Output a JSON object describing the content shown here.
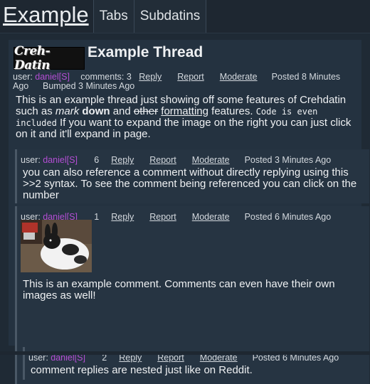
{
  "nav": {
    "brand": "Example",
    "tabs": [
      "Tabs",
      "Subdatins"
    ]
  },
  "thread": {
    "logo_text": "Creh-Datin",
    "title": "Example Thread",
    "meta": {
      "user_label": "user:",
      "user": "daniel[S]",
      "comments": "comments: 3",
      "reply": "Reply",
      "report": "Report",
      "moderate": "Moderate",
      "posted": "Posted 8 Minutes Ago",
      "bumped": "Bumped 3 Minutes Ago"
    },
    "body": {
      "p1": "This is an example thread just showing off some features of Crehdatin such as ",
      "italic": "mark",
      "p2": " ",
      "bold": "down",
      "p3": " and ",
      "strike": "other",
      "p4": " ",
      "underline": "formatting",
      "p5": " features. ",
      "code": "Code is even included",
      "p6": " If you want to expand the image on the right you can just click on it and it'll expand in page."
    }
  },
  "comments": [
    {
      "user_label": "user:",
      "user": "daniel[S]",
      "number": "6",
      "reply": "Reply",
      "report": "Report",
      "moderate": "Moderate",
      "posted": "Posted 3 Minutes Ago",
      "body": "you can also reference a comment without directly replying using this >>2 syntax. To see the comment being referenced you can click on the number"
    },
    {
      "user_label": "user:",
      "user": "daniel[S]",
      "number": "1",
      "reply": "Reply",
      "report": "Report",
      "moderate": "Moderate",
      "posted": "Posted 6 Minutes Ago",
      "body": "This is an example comment. Comments can even have their own images as well!"
    },
    {
      "user_label": "user:",
      "user": "daniel[S]",
      "number": "2",
      "reply": "Reply",
      "report": "Report",
      "moderate": "Moderate",
      "posted": "Posted 6 Minutes Ago",
      "body": "comment replies are nested just like on Reddit."
    }
  ],
  "colors": {
    "background": "#1f2a35",
    "username": "#b44ed4",
    "text": "#eef0f2"
  }
}
